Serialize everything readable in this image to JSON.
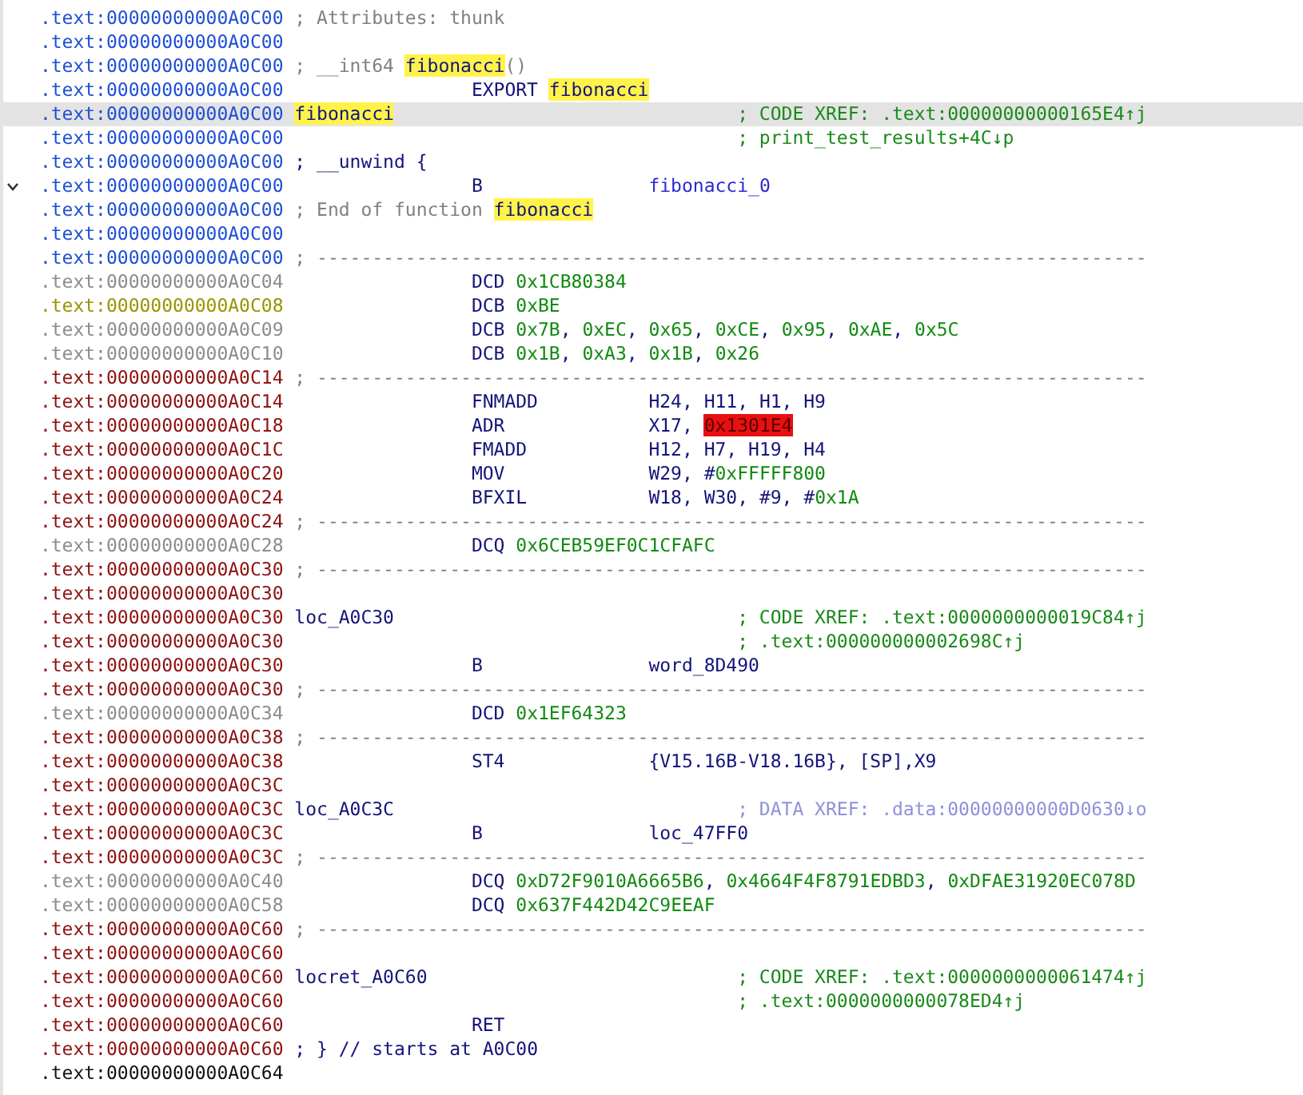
{
  "lines": [
    {
      "address": {
        "text": ".text:00000000000A0C00",
        "kind": "function"
      },
      "selected": false,
      "kind": "remark",
      "remark": [
        {
          "text": "; Attributes: thunk",
          "kind": "comment"
        }
      ]
    },
    {
      "address": {
        "text": ".text:00000000000A0C00",
        "kind": "function"
      },
      "selected": false,
      "kind": "blank"
    },
    {
      "address": {
        "text": ".text:00000000000A0C00",
        "kind": "function"
      },
      "selected": false,
      "kind": "remark",
      "remark": [
        {
          "text": "; __int64 ",
          "kind": "comment"
        },
        {
          "text": "fibonacci",
          "kind": "highlight"
        },
        {
          "text": "()",
          "kind": "comment"
        }
      ]
    },
    {
      "address": {
        "text": ".text:00000000000A0C00",
        "kind": "function"
      },
      "selected": false,
      "kind": "directive",
      "mnemonic": "EXPORT",
      "operands": [
        {
          "text": "fibonacci",
          "kind": "highlight"
        }
      ]
    },
    {
      "address": {
        "text": ".text:00000000000A0C00",
        "kind": "function"
      },
      "selected": true,
      "kind": "instruction",
      "label": [
        {
          "text": "fibonacci",
          "kind": "highlight"
        }
      ],
      "comment": [
        {
          "text": "; CODE XREF: .text:00000000000165E4↑j",
          "kind": "xref"
        }
      ]
    },
    {
      "address": {
        "text": ".text:00000000000A0C00",
        "kind": "function"
      },
      "selected": false,
      "kind": "instruction",
      "comment": [
        {
          "text": "; print_test_results+4C↓p",
          "kind": "xref"
        }
      ]
    },
    {
      "address": {
        "text": ".text:00000000000A0C00",
        "kind": "function"
      },
      "selected": false,
      "kind": "remark",
      "remark": [
        {
          "text": "; __unwind {",
          "kind": "keyword"
        }
      ]
    },
    {
      "address": {
        "text": ".text:00000000000A0C00",
        "kind": "function"
      },
      "selected": false,
      "expanded": true,
      "kind": "instruction",
      "mnemonic": "B",
      "operands": [
        {
          "text": "fibonacci_0",
          "kind": "name"
        }
      ]
    },
    {
      "address": {
        "text": ".text:00000000000A0C00",
        "kind": "function"
      },
      "selected": false,
      "kind": "remark",
      "remark": [
        {
          "text": "; End of function ",
          "kind": "comment"
        },
        {
          "text": "fibonacci",
          "kind": "highlight"
        }
      ]
    },
    {
      "address": {
        "text": ".text:00000000000A0C00",
        "kind": "function"
      },
      "selected": false,
      "kind": "blank"
    },
    {
      "address": {
        "text": ".text:00000000000A0C00",
        "kind": "function"
      },
      "selected": false,
      "kind": "remark",
      "remark": [
        {
          "text": "; ---------------------------------------------------------------------------",
          "kind": "comment"
        }
      ]
    },
    {
      "address": {
        "text": ".text:00000000000A0C04",
        "kind": "data"
      },
      "selected": false,
      "kind": "directive",
      "mnemonic": "DCD",
      "operands": [
        {
          "text": "0x1CB80384",
          "kind": "number"
        }
      ]
    },
    {
      "address": {
        "text": ".text:00000000000A0C08",
        "kind": "unexplored"
      },
      "selected": false,
      "kind": "directive",
      "mnemonic": "DCB",
      "operands": [
        {
          "text": "0xBE",
          "kind": "number"
        }
      ]
    },
    {
      "address": {
        "text": ".text:00000000000A0C09",
        "kind": "data"
      },
      "selected": false,
      "kind": "directive",
      "mnemonic": "DCB",
      "operands": [
        {
          "text": "0x7B",
          "kind": "number"
        },
        {
          "text": ", ",
          "kind": "keyword"
        },
        {
          "text": "0xEC",
          "kind": "number"
        },
        {
          "text": ", ",
          "kind": "keyword"
        },
        {
          "text": "0x65",
          "kind": "number"
        },
        {
          "text": ", ",
          "kind": "keyword"
        },
        {
          "text": "0xCE",
          "kind": "number"
        },
        {
          "text": ", ",
          "kind": "keyword"
        },
        {
          "text": "0x95",
          "kind": "number"
        },
        {
          "text": ", ",
          "kind": "keyword"
        },
        {
          "text": "0xAE",
          "kind": "number"
        },
        {
          "text": ", ",
          "kind": "keyword"
        },
        {
          "text": "0x5C",
          "kind": "number"
        }
      ]
    },
    {
      "address": {
        "text": ".text:00000000000A0C10",
        "kind": "data"
      },
      "selected": false,
      "kind": "directive",
      "mnemonic": "DCB",
      "operands": [
        {
          "text": "0x1B",
          "kind": "number"
        },
        {
          "text": ", ",
          "kind": "keyword"
        },
        {
          "text": "0xA3",
          "kind": "number"
        },
        {
          "text": ", ",
          "kind": "keyword"
        },
        {
          "text": "0x1B",
          "kind": "number"
        },
        {
          "text": ", ",
          "kind": "keyword"
        },
        {
          "text": "0x26",
          "kind": "number"
        }
      ]
    },
    {
      "address": {
        "text": ".text:00000000000A0C14",
        "kind": "code"
      },
      "selected": false,
      "kind": "remark",
      "remark": [
        {
          "text": "; ---------------------------------------------------------------------------",
          "kind": "comment"
        }
      ]
    },
    {
      "address": {
        "text": ".text:00000000000A0C14",
        "kind": "code"
      },
      "selected": false,
      "kind": "instruction",
      "mnemonic": "FNMADD",
      "operands": [
        {
          "text": "H24, H11, H1, H9",
          "kind": "keyword"
        }
      ]
    },
    {
      "address": {
        "text": ".text:00000000000A0C18",
        "kind": "code"
      },
      "selected": false,
      "kind": "instruction",
      "mnemonic": "ADR",
      "operands": [
        {
          "text": "X17, ",
          "kind": "keyword"
        },
        {
          "text": "0x1301E4",
          "kind": "error"
        }
      ]
    },
    {
      "address": {
        "text": ".text:00000000000A0C1C",
        "kind": "code"
      },
      "selected": false,
      "kind": "instruction",
      "mnemonic": "FMADD",
      "operands": [
        {
          "text": "H12, H7, H19, H4",
          "kind": "keyword"
        }
      ]
    },
    {
      "address": {
        "text": ".text:00000000000A0C20",
        "kind": "code"
      },
      "selected": false,
      "kind": "instruction",
      "mnemonic": "MOV",
      "operands": [
        {
          "text": "W29, #",
          "kind": "keyword"
        },
        {
          "text": "0xFFFFF800",
          "kind": "number"
        }
      ]
    },
    {
      "address": {
        "text": ".text:00000000000A0C24",
        "kind": "code"
      },
      "selected": false,
      "kind": "instruction",
      "mnemonic": "BFXIL",
      "operands": [
        {
          "text": "W18, W30, #9, #",
          "kind": "keyword"
        },
        {
          "text": "0x1A",
          "kind": "number"
        }
      ]
    },
    {
      "address": {
        "text": ".text:00000000000A0C24",
        "kind": "code"
      },
      "selected": false,
      "kind": "remark",
      "remark": [
        {
          "text": "; ---------------------------------------------------------------------------",
          "kind": "comment"
        }
      ]
    },
    {
      "address": {
        "text": ".text:00000000000A0C28",
        "kind": "data"
      },
      "selected": false,
      "kind": "directive",
      "mnemonic": "DCQ",
      "operands": [
        {
          "text": "0x6CEB59EF0C1CFAFC",
          "kind": "number"
        }
      ]
    },
    {
      "address": {
        "text": ".text:00000000000A0C30",
        "kind": "code"
      },
      "selected": false,
      "kind": "remark",
      "remark": [
        {
          "text": "; ---------------------------------------------------------------------------",
          "kind": "comment"
        }
      ]
    },
    {
      "address": {
        "text": ".text:00000000000A0C30",
        "kind": "code"
      },
      "selected": false,
      "kind": "blank"
    },
    {
      "address": {
        "text": ".text:00000000000A0C30",
        "kind": "code"
      },
      "selected": false,
      "kind": "instruction",
      "label": [
        {
          "text": "loc_A0C30",
          "kind": "keyword"
        }
      ],
      "comment": [
        {
          "text": "; CODE XREF: .text:0000000000019C84↑j",
          "kind": "xref"
        }
      ]
    },
    {
      "address": {
        "text": ".text:00000000000A0C30",
        "kind": "code"
      },
      "selected": false,
      "kind": "instruction",
      "comment": [
        {
          "text": "; .text:000000000002698C↑j",
          "kind": "xref"
        }
      ]
    },
    {
      "address": {
        "text": ".text:00000000000A0C30",
        "kind": "code"
      },
      "selected": false,
      "kind": "instruction",
      "mnemonic": "B",
      "operands": [
        {
          "text": "word_8D490",
          "kind": "keyword"
        }
      ]
    },
    {
      "address": {
        "text": ".text:00000000000A0C30",
        "kind": "code"
      },
      "selected": false,
      "kind": "remark",
      "remark": [
        {
          "text": "; ---------------------------------------------------------------------------",
          "kind": "comment"
        }
      ]
    },
    {
      "address": {
        "text": ".text:00000000000A0C34",
        "kind": "data"
      },
      "selected": false,
      "kind": "directive",
      "mnemonic": "DCD",
      "operands": [
        {
          "text": "0x1EF64323",
          "kind": "number"
        }
      ]
    },
    {
      "address": {
        "text": ".text:00000000000A0C38",
        "kind": "code"
      },
      "selected": false,
      "kind": "remark",
      "remark": [
        {
          "text": "; ---------------------------------------------------------------------------",
          "kind": "comment"
        }
      ]
    },
    {
      "address": {
        "text": ".text:00000000000A0C38",
        "kind": "code"
      },
      "selected": false,
      "kind": "instruction",
      "mnemonic": "ST4",
      "operands": [
        {
          "text": "{V15.16B-V18.16B}, [SP],X9",
          "kind": "keyword"
        }
      ]
    },
    {
      "address": {
        "text": ".text:00000000000A0C3C",
        "kind": "code"
      },
      "selected": false,
      "kind": "blank"
    },
    {
      "address": {
        "text": ".text:00000000000A0C3C",
        "kind": "code"
      },
      "selected": false,
      "kind": "instruction",
      "label": [
        {
          "text": "loc_A0C3C",
          "kind": "keyword"
        }
      ],
      "comment": [
        {
          "text": "; DATA XREF: .data:00000000000D0630↓o",
          "kind": "dataxref"
        }
      ]
    },
    {
      "address": {
        "text": ".text:00000000000A0C3C",
        "kind": "code"
      },
      "selected": false,
      "kind": "instruction",
      "mnemonic": "B",
      "operands": [
        {
          "text": "loc_47FF0",
          "kind": "keyword"
        }
      ]
    },
    {
      "address": {
        "text": ".text:00000000000A0C3C",
        "kind": "code"
      },
      "selected": false,
      "kind": "remark",
      "remark": [
        {
          "text": "; ---------------------------------------------------------------------------",
          "kind": "comment"
        }
      ]
    },
    {
      "address": {
        "text": ".text:00000000000A0C40",
        "kind": "data"
      },
      "selected": false,
      "kind": "directive",
      "mnemonic": "DCQ",
      "operands": [
        {
          "text": "0xD72F9010A6665B6",
          "kind": "number"
        },
        {
          "text": ", ",
          "kind": "keyword"
        },
        {
          "text": "0x4664F4F8791EDBD3",
          "kind": "number"
        },
        {
          "text": ", ",
          "kind": "keyword"
        },
        {
          "text": "0xDFAE31920EC078D",
          "kind": "number"
        }
      ]
    },
    {
      "address": {
        "text": ".text:00000000000A0C58",
        "kind": "data"
      },
      "selected": false,
      "kind": "directive",
      "mnemonic": "DCQ",
      "operands": [
        {
          "text": "0x637F442D42C9EEAF",
          "kind": "number"
        }
      ]
    },
    {
      "address": {
        "text": ".text:00000000000A0C60",
        "kind": "code"
      },
      "selected": false,
      "kind": "remark",
      "remark": [
        {
          "text": "; ---------------------------------------------------------------------------",
          "kind": "comment"
        }
      ]
    },
    {
      "address": {
        "text": ".text:00000000000A0C60",
        "kind": "code"
      },
      "selected": false,
      "kind": "blank"
    },
    {
      "address": {
        "text": ".text:00000000000A0C60",
        "kind": "code"
      },
      "selected": false,
      "kind": "instruction",
      "label": [
        {
          "text": "locret_A0C60",
          "kind": "keyword"
        }
      ],
      "comment": [
        {
          "text": "; CODE XREF: .text:0000000000061474↑j",
          "kind": "xref"
        }
      ]
    },
    {
      "address": {
        "text": ".text:00000000000A0C60",
        "kind": "code"
      },
      "selected": false,
      "kind": "instruction",
      "comment": [
        {
          "text": "; .text:0000000000078ED4↑j",
          "kind": "xref"
        }
      ]
    },
    {
      "address": {
        "text": ".text:00000000000A0C60",
        "kind": "code"
      },
      "selected": false,
      "kind": "instruction",
      "mnemonic": "RET"
    },
    {
      "address": {
        "text": ".text:00000000000A0C60",
        "kind": "code"
      },
      "selected": false,
      "kind": "remark",
      "remark": [
        {
          "text": "; } // starts at A0C00",
          "kind": "keyword"
        }
      ]
    },
    {
      "address": {
        "text": ".text:00000000000A0C64",
        "kind": "plain"
      },
      "selected": false,
      "kind": "blank"
    }
  ]
}
